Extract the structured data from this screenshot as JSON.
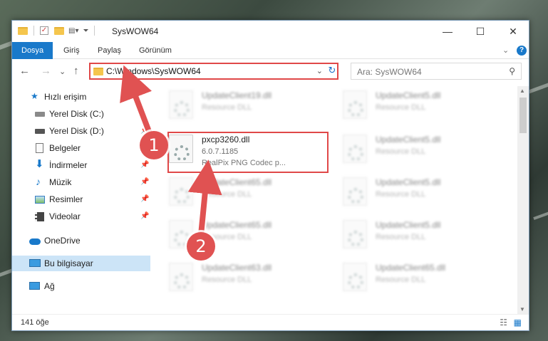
{
  "window": {
    "title": "SysWOW64",
    "controls": {
      "minimize": "—",
      "maximize": "☐",
      "close": "✕"
    }
  },
  "ribbon": {
    "tabs": [
      "Dosya",
      "Giriş",
      "Paylaş",
      "Görünüm"
    ],
    "collapse_glyph": "⌄",
    "help_glyph": "?"
  },
  "address": {
    "path": "C:\\Windows\\SysWOW64",
    "search_placeholder": "Ara: SysWOW64",
    "nav": {
      "back": "←",
      "forward": "→",
      "recent": "⌄",
      "up": "↑"
    },
    "refresh_glyph": "↻",
    "search_glyph": "⚲",
    "dropdown_glyph": "⌄"
  },
  "sidebar": {
    "items": [
      {
        "label": "Hızlı erişim",
        "icon": "star-icon"
      },
      {
        "label": "Yerel Disk (C:)",
        "icon": "drive-icon"
      },
      {
        "label": "Yerel Disk (D:)",
        "icon": "drive-icon",
        "pinned": true
      },
      {
        "label": "Belgeler",
        "icon": "documents-icon",
        "pinned": true
      },
      {
        "label": "İndirmeler",
        "icon": "download-icon",
        "pinned": true
      },
      {
        "label": "Müzik",
        "icon": "music-icon",
        "pinned": true
      },
      {
        "label": "Resimler",
        "icon": "pictures-icon",
        "pinned": true
      },
      {
        "label": "Videolar",
        "icon": "videos-icon",
        "pinned": true
      },
      {
        "label": "OneDrive",
        "icon": "cloud-icon"
      },
      {
        "label": "Bu bilgisayar",
        "icon": "computer-icon",
        "selected": true
      },
      {
        "label": "Ağ",
        "icon": "network-icon"
      }
    ]
  },
  "files": {
    "left": [
      {
        "name": "UpdateClient19.dll",
        "desc": "Resource DLL"
      },
      {
        "name": "pxcp3260.dll",
        "version": "6.0.7.1185",
        "desc": "RealPix PNG Codec p...",
        "highlighted": true
      },
      {
        "name": "UpdateClient65.dll",
        "desc": "Resource DLL"
      },
      {
        "name": "UpdateClient65.dll",
        "desc": "Resource DLL"
      },
      {
        "name": "UpdateClient63.dll",
        "desc": "Resource DLL"
      }
    ],
    "right": [
      {
        "name": "UpdateClient5.dll",
        "desc": "Resource DLL"
      },
      {
        "name": "UpdateClient5.dll",
        "desc": "Resource DLL"
      },
      {
        "name": "UpdateClient5.dll",
        "desc": "Resource DLL"
      },
      {
        "name": "UpdateClient5.dll",
        "desc": "Resource DLL"
      },
      {
        "name": "UpdateClient65.dll",
        "desc": "Resource DLL"
      }
    ]
  },
  "status": {
    "count": "141 öğe"
  },
  "callouts": {
    "one": "1",
    "two": "2"
  },
  "colors": {
    "accent": "#1979ca",
    "highlight": "#e04848",
    "callout": "#e05252",
    "selected_bg": "#cce4f7"
  }
}
